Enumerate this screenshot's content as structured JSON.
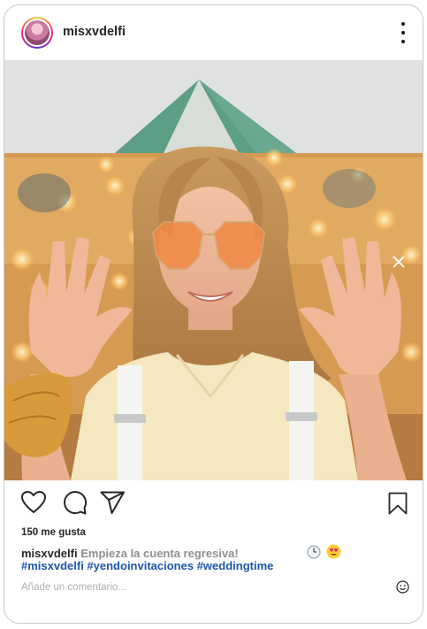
{
  "post": {
    "username": "misxvdelfi",
    "likes": "150 me gusta",
    "caption_user": "misxvdelfi",
    "caption_text": "Empieza la cuenta regresiva!",
    "caption_emojis": [
      "clock-emoji",
      "heart-eyes-emoji"
    ],
    "hashtags": "#misxvdelfi #yendoinvitaciones #weddingtime",
    "comment_placeholder": "Añade un comentario..."
  },
  "icons": {
    "menu": "more-options-icon",
    "like": "heart-icon",
    "comment": "comment-icon",
    "share": "paper-plane-icon",
    "save": "bookmark-icon",
    "emoji": "smiley-icon"
  },
  "colors": {
    "hashtag": "#1a56a8",
    "caption_gray": "#8e8e8e",
    "card_border": "#c9c9c9"
  }
}
